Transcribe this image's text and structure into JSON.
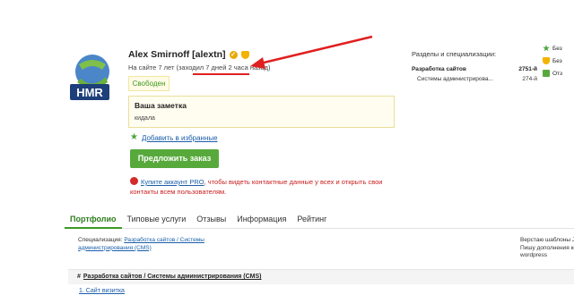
{
  "profile": {
    "name": "Alex Smirnoff [alextn]",
    "since": "На сайте 7 лет (заходил 7 дней 2 часа назад)",
    "status": "Свободен",
    "avatar_text": "HMR"
  },
  "note": {
    "title": "Ваша заметка",
    "text": "кидала"
  },
  "favorites_link": "Добавить в избранные",
  "order_button": "Предложить заказ",
  "pro_notice": {
    "link": "Купите аккаунт PRO",
    "text": ", чтобы видеть контактные данные у всех и открыть свои контакты всем пользователям."
  },
  "specializations": {
    "title": "Разделы и специализации:",
    "rows": [
      {
        "label": "Разработка сайтов",
        "value": "2751-й"
      },
      {
        "label": "Системы администрирова...",
        "value": "274-й"
      }
    ]
  },
  "side_items": [
    {
      "label": "Без",
      "icon": "star-icon",
      "color": "#47a83b"
    },
    {
      "label": "Без",
      "icon": "shield-icon",
      "color": "#f2b400"
    },
    {
      "label": "Отз",
      "icon": "comment-icon",
      "color": "#58a93c"
    }
  ],
  "tabs": [
    {
      "label": "Портфолио",
      "active": true
    },
    {
      "label": "Типовые услуги",
      "active": false
    },
    {
      "label": "Отзывы",
      "active": false
    },
    {
      "label": "Информация",
      "active": false
    },
    {
      "label": "Рейтинг",
      "active": false
    }
  ],
  "portfolio_spec": {
    "label": "Специализация:",
    "link1": "Разработка сайтов / Системы",
    "link2": "администрирования (CMS)"
  },
  "right_desc": [
    "Верстаю шаблоны Jo",
    "Пишу дополнения ко",
    "wordpress"
  ],
  "section": {
    "hash": "#",
    "title": "Разработка сайтов / Системы администрирования (CMS)"
  },
  "list_first": "1. Сайт визитка",
  "colors": {
    "accent_green": "#58a93c",
    "link_blue": "#1a5ea8",
    "warning_red": "#c81e1e",
    "arrow_red": "#e02020"
  }
}
